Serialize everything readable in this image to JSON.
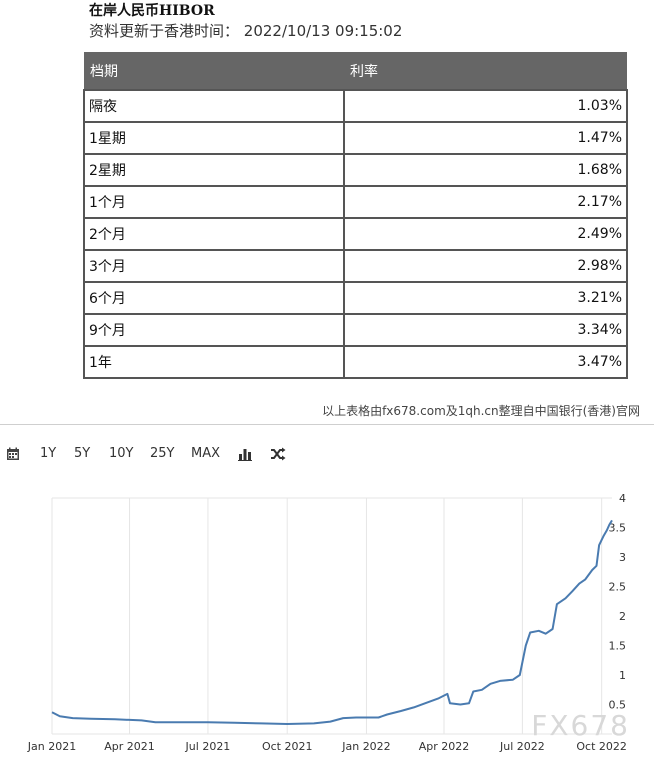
{
  "header": {
    "title": "在岸人民币HIBOR",
    "updated_label": "资料更新于香港时间：",
    "updated_time": "2022/10/13 09:15:02"
  },
  "table": {
    "columns": [
      "档期",
      "利率"
    ],
    "rows": [
      {
        "term": "隔夜",
        "rate": "1.03%"
      },
      {
        "term": "1星期",
        "rate": "1.47%"
      },
      {
        "term": "2星期",
        "rate": "1.68%"
      },
      {
        "term": "1个月",
        "rate": "2.17%"
      },
      {
        "term": "2个月",
        "rate": "2.49%"
      },
      {
        "term": "3个月",
        "rate": "2.98%"
      },
      {
        "term": "6个月",
        "rate": "3.21%"
      },
      {
        "term": "9个月",
        "rate": "3.34%"
      },
      {
        "term": "1年",
        "rate": "3.47%"
      }
    ]
  },
  "source_note": "以上表格由fx678.com及1qh.cn整理自中国银行(香港)官网",
  "toolbar": {
    "items": [
      "1Y",
      "5Y",
      "10Y",
      "25Y",
      "MAX"
    ],
    "icons": [
      "calendar-icon",
      "bar-chart-icon",
      "shuffle-icon"
    ]
  },
  "watermark": "FX678",
  "chart_data": {
    "type": "line",
    "title": "",
    "xlabel": "",
    "ylabel": "",
    "x_ticks": [
      "Jan 2021",
      "Apr 2021",
      "Jul 2021",
      "Oct 2021",
      "Jan 2022",
      "Apr 2022",
      "Jul 2022",
      "Oct 2022"
    ],
    "y_ticks": [
      "4",
      "3.5",
      "3",
      "2.5",
      "2",
      "1.5",
      "1",
      "0.5"
    ],
    "ylim": [
      0,
      4
    ],
    "xlim": [
      "2021-01-01",
      "2022-10-13"
    ],
    "grid": "vertical",
    "color": "#4a7bb0",
    "series": [
      {
        "points": [
          [
            "2021-01-01",
            0.37
          ],
          [
            "2021-01-10",
            0.3
          ],
          [
            "2021-01-25",
            0.27
          ],
          [
            "2021-02-15",
            0.26
          ],
          [
            "2021-03-15",
            0.25
          ],
          [
            "2021-04-15",
            0.23
          ],
          [
            "2021-05-01",
            0.2
          ],
          [
            "2021-06-01",
            0.2
          ],
          [
            "2021-07-01",
            0.2
          ],
          [
            "2021-08-01",
            0.19
          ],
          [
            "2021-09-01",
            0.18
          ],
          [
            "2021-10-01",
            0.17
          ],
          [
            "2021-11-01",
            0.18
          ],
          [
            "2021-11-20",
            0.21
          ],
          [
            "2021-12-05",
            0.27
          ],
          [
            "2021-12-20",
            0.28
          ],
          [
            "2022-01-15",
            0.28
          ],
          [
            "2022-01-25",
            0.33
          ],
          [
            "2022-02-10",
            0.39
          ],
          [
            "2022-02-25",
            0.45
          ],
          [
            "2022-03-10",
            0.52
          ],
          [
            "2022-03-25",
            0.6
          ],
          [
            "2022-04-05",
            0.68
          ],
          [
            "2022-04-08",
            0.52
          ],
          [
            "2022-04-20",
            0.5
          ],
          [
            "2022-04-30",
            0.52
          ],
          [
            "2022-05-05",
            0.72
          ],
          [
            "2022-05-15",
            0.75
          ],
          [
            "2022-05-25",
            0.85
          ],
          [
            "2022-06-05",
            0.9
          ],
          [
            "2022-06-20",
            0.92
          ],
          [
            "2022-06-28",
            1.0
          ],
          [
            "2022-07-05",
            1.5
          ],
          [
            "2022-07-10",
            1.72
          ],
          [
            "2022-07-20",
            1.75
          ],
          [
            "2022-07-28",
            1.7
          ],
          [
            "2022-08-05",
            1.78
          ],
          [
            "2022-08-10",
            2.2
          ],
          [
            "2022-08-20",
            2.3
          ],
          [
            "2022-08-28",
            2.42
          ],
          [
            "2022-09-05",
            2.55
          ],
          [
            "2022-09-12",
            2.62
          ],
          [
            "2022-09-20",
            2.78
          ],
          [
            "2022-09-25",
            2.85
          ],
          [
            "2022-09-28",
            3.2
          ],
          [
            "2022-10-03",
            3.35
          ],
          [
            "2022-10-07",
            3.45
          ],
          [
            "2022-10-10",
            3.55
          ],
          [
            "2022-10-13",
            3.62
          ]
        ]
      }
    ]
  }
}
